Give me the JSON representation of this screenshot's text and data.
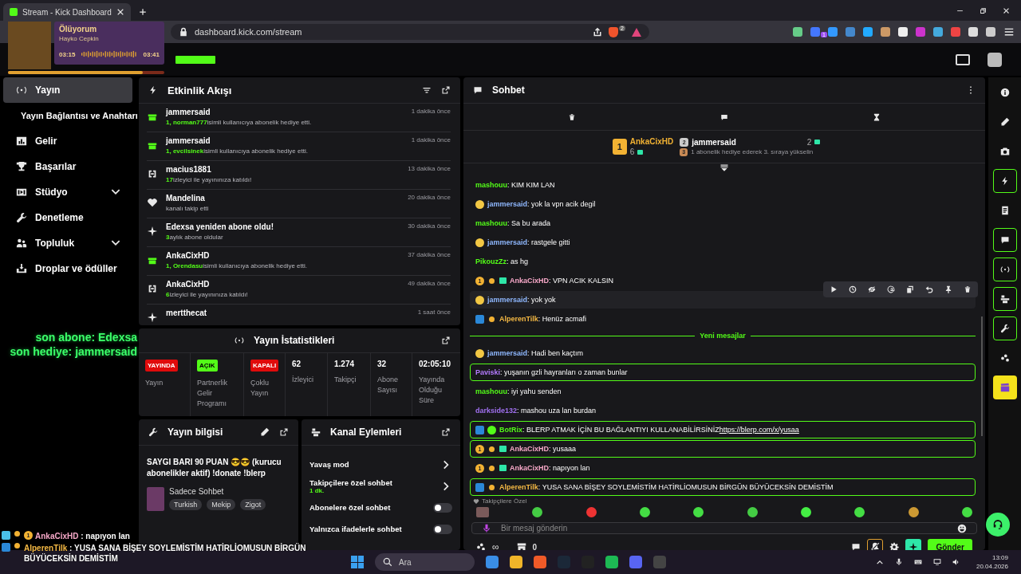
{
  "browser": {
    "tab_title": "Stream - Kick Dashboard",
    "url": "dashboard.kick.com/stream",
    "shield_count": "2",
    "extension_badge": "1"
  },
  "music_overlay": {
    "title": "Ölüyorum",
    "artist": "Hayko Cepkin",
    "elapsed": "03:15",
    "duration": "03:41",
    "level": 0.86
  },
  "sidebar": {
    "items": [
      {
        "label": "Yayın",
        "kind": "item",
        "selected": true,
        "expandable": false
      },
      {
        "label": "Yayın Bağlantısı ve Anahtarı",
        "kind": "subitem",
        "selected": false,
        "expandable": false
      },
      {
        "label": "Gelir",
        "kind": "item",
        "selected": false,
        "expandable": false
      },
      {
        "label": "Başarılar",
        "kind": "item",
        "selected": false,
        "expandable": false
      },
      {
        "label": "Stüdyo",
        "kind": "item",
        "selected": false,
        "expandable": true
      },
      {
        "label": "Denetleme",
        "kind": "item",
        "selected": false,
        "expandable": false
      },
      {
        "label": "Topluluk",
        "kind": "item",
        "selected": false,
        "expandable": true
      },
      {
        "label": "Droplar ve ödüller",
        "kind": "item",
        "selected": false,
        "expandable": false
      }
    ]
  },
  "stream_overlay": {
    "labels": [
      "son abone: Edexsa",
      "son hediye: jammersaid"
    ],
    "chat_lines": [
      {
        "badges": [
          {
            "kind": "cube"
          },
          {
            "kind": "dot"
          },
          {
            "kind": "rank",
            "label": "1"
          }
        ],
        "user": "AnkaCixHD",
        "color": "#f7a8c8",
        "text": ": napıyon lan"
      },
      {
        "badges": [
          {
            "kind": "mod"
          },
          {
            "kind": "dot"
          }
        ],
        "user": "AlperenTilk",
        "color": "#f5b944",
        "text": ": YUSA SANA BİŞEY SOYLEMİSTİM HATİRLİOMUSUN BİRGÜN BÜYÜCEKSİN DEMİSTİM"
      }
    ]
  },
  "event_feed": {
    "title": "Etkinlik Akışı",
    "items": [
      {
        "kind": "gift",
        "name": "jammersaid",
        "time": "1 dakika önce",
        "highlight": "1, norman777",
        "detail": "isimli kullanıcıya abonelik hediye etti."
      },
      {
        "kind": "gift",
        "name": "jammersaid",
        "time": "1 dakika önce",
        "highlight": "1, evcilsinek",
        "detail": "isimli kullanıcıya abonelik hediye etti."
      },
      {
        "kind": "raid",
        "name": "macius1881",
        "time": "13 dakika önce",
        "highlight": "17",
        "detail": "izleyici ile yayınınıza katıldı!"
      },
      {
        "kind": "follow",
        "name": "Mandelina",
        "time": "20 dakika önce",
        "detail": "kanalı takip etti"
      },
      {
        "kind": "resub",
        "name": "Edexsa yeniden abone oldu!",
        "time": "30 dakika önce",
        "highlight": "3",
        "detail": "aylık abone oldular"
      },
      {
        "kind": "gift",
        "name": "AnkaCixHD",
        "time": "37 dakika önce",
        "highlight": "1, Orendasu",
        "detail": "isimli kullanıcıya abonelik hediye etti."
      },
      {
        "kind": "raid",
        "name": "AnkaCixHD",
        "time": "49 dakika önce",
        "highlight": "6",
        "detail": "izleyici ile yayınınıza katıldı!"
      },
      {
        "kind": "resub",
        "name": "mertthecat",
        "time": "1 saat önce"
      }
    ]
  },
  "stream_stats": {
    "title": "Yayın İstatistikleri",
    "items": [
      {
        "kind": "badge",
        "value": "YAYINDA",
        "color": "#e00b0b",
        "label": "Yayın"
      },
      {
        "kind": "badge",
        "value": "AÇIK",
        "color": "#53fc18",
        "label": "Partnerlik Gelir Programı"
      },
      {
        "kind": "badge",
        "value": "KAPALI",
        "color": "#e00b0b",
        "label": "Çoklu Yayın"
      },
      {
        "kind": "number",
        "value": "62",
        "label": "İzleyici"
      },
      {
        "kind": "number",
        "value": "1.274",
        "label": "Takipçi"
      },
      {
        "kind": "number",
        "value": "32",
        "label": "Abone Sayısı"
      },
      {
        "kind": "number",
        "value": "02:05:10",
        "label": "Yayında Olduğu Süre"
      }
    ]
  },
  "stream_info": {
    "title": "Yayın bilgisi",
    "stream_title": "SAYGI BARI 90 PUAN 😎😎 (kurucu abonelikler aktif) !donate !blerp",
    "category": "Sadece Sohbet",
    "tags": [
      "Turkish",
      "Mekip",
      "Zigot"
    ]
  },
  "channel_actions": {
    "title": "Kanal Eylemleri",
    "items": [
      {
        "kind": "link",
        "label": "Yavaş mod"
      },
      {
        "kind": "link",
        "label": "Takipçilere özel sohbet",
        "sub": "1 dk."
      },
      {
        "kind": "toggle",
        "label": "Abonelere özel sohbet",
        "on": false
      },
      {
        "kind": "toggle",
        "label": "Yalnızca ifadelerle sohbet",
        "on": false
      }
    ]
  },
  "chat": {
    "title": "Sohbet",
    "leaders": [
      {
        "rank": "1",
        "name": "AnkaCixHD",
        "count": "6"
      },
      {
        "rank": "2",
        "name": "jammersaid",
        "count": "2"
      }
    ],
    "leader_hint": {
      "rank": "3",
      "text": "1 abonelik hediye ederek 3. sıraya yükselin"
    },
    "messages": [
      {
        "kind": "message",
        "user": "mashouu",
        "color": "#53fc18",
        "text": ": KIM KIM LAN",
        "highlighted": false,
        "hovered": false
      },
      {
        "kind": "message",
        "badges": [
          {
            "kind": "emoji"
          }
        ],
        "user": "jammersaid",
        "color": "#8fb8ff",
        "text": ": yok la vpn acik degil",
        "highlighted": false,
        "hovered": false
      },
      {
        "kind": "message",
        "user": "mashouu",
        "color": "#53fc18",
        "text": ": Sa bu arada",
        "highlighted": false,
        "hovered": false
      },
      {
        "kind": "message",
        "badges": [
          {
            "kind": "emoji"
          }
        ],
        "user": "jammersaid",
        "color": "#8fb8ff",
        "text": ": rastgele gitti",
        "highlighted": false,
        "hovered": false
      },
      {
        "kind": "message",
        "user": "PikouzZz",
        "color": "#53fc18",
        "text": ": as hg",
        "highlighted": false,
        "hovered": false
      },
      {
        "kind": "message",
        "badges": [
          {
            "kind": "rank",
            "label": "1"
          },
          {
            "kind": "dot"
          },
          {
            "kind": "gift"
          }
        ],
        "user": "AnkaCixHD",
        "color": "#f7a8c8",
        "text": ": VPN ACIK KALSIN",
        "highlighted": false,
        "hovered": false
      },
      {
        "kind": "message",
        "badges": [
          {
            "kind": "emoji"
          }
        ],
        "user": "jammersaid",
        "color": "#8fb8ff",
        "text": ": yok yok",
        "highlighted": false,
        "hovered": true
      },
      {
        "kind": "message",
        "badges": [
          {
            "kind": "mod"
          },
          {
            "kind": "dot"
          }
        ],
        "user": "AlperenTilk",
        "color": "#f5b944",
        "text": ": Henüz acmafi",
        "highlighted": false,
        "hovered": false
      },
      {
        "kind": "divider",
        "label": "Yeni mesajlar"
      },
      {
        "kind": "message",
        "badges": [
          {
            "kind": "emoji"
          }
        ],
        "user": "jammersaid",
        "color": "#8fb8ff",
        "text": ": Hadi ben kaçtım",
        "highlighted": false,
        "hovered": false
      },
      {
        "kind": "message",
        "user": "Paviski",
        "color": "#b57bff",
        "text": ": yuşanın gzli hayranları o zaman bunlar",
        "highlighted": true,
        "hovered": false
      },
      {
        "kind": "message",
        "user": "mashouu",
        "color": "#53fc18",
        "text": ": iyi yahu senden",
        "highlighted": false,
        "hovered": false
      },
      {
        "kind": "message",
        "user": "darkside132",
        "color": "#a070f0",
        "text": ": mashou uza lan burdan",
        "highlighted": false,
        "hovered": false
      },
      {
        "kind": "message",
        "badges": [
          {
            "kind": "mod"
          },
          {
            "kind": "verified"
          }
        ],
        "user": "BotRix",
        "color": "#53fc18",
        "text": ": BLERP ATMAK İÇİN BU BAĞLANTIYI KULLANABİLİRSİNİZ",
        "link": "https://blerp.com/x/yusaa",
        "highlighted": true,
        "hovered": false
      },
      {
        "kind": "message",
        "badges": [
          {
            "kind": "rank",
            "label": "1"
          },
          {
            "kind": "dot"
          },
          {
            "kind": "gift"
          }
        ],
        "user": "AnkaCixHD",
        "color": "#f7a8c8",
        "text": ": yusaaa",
        "highlighted": true,
        "hovered": false
      },
      {
        "kind": "message",
        "badges": [
          {
            "kind": "rank",
            "label": "1"
          },
          {
            "kind": "dot"
          },
          {
            "kind": "gift"
          }
        ],
        "user": "AnkaCixHD",
        "color": "#f7a8c8",
        "text": ": napıyon lan",
        "highlighted": false,
        "hovered": false
      },
      {
        "kind": "message",
        "badges": [
          {
            "kind": "mod"
          },
          {
            "kind": "dot"
          }
        ],
        "user": "AlperenTilk",
        "color": "#f5b944",
        "text": ": YUSA SANA BİŞEY SOYLEMİSTİM HATİRLİOMUSUN BİRGÜN BÜYÜCEKSİN DEMİSTİM",
        "highlighted": true,
        "hovered": false
      }
    ],
    "emote_section": "Takipçilere Özel",
    "input_placeholder": "Bir mesaj gönderin",
    "points": "∞",
    "store_count": "0",
    "send_label": "Gönder"
  },
  "right_rail": [
    {
      "on": false
    },
    {
      "on": false
    },
    {
      "on": false
    },
    {
      "on": true
    },
    {
      "on": false
    },
    {
      "on": true
    },
    {
      "on": true
    },
    {
      "on": true
    },
    {
      "on": true
    },
    {
      "on": false
    },
    {
      "on": false
    }
  ],
  "taskbar": {
    "search_placeholder": "Ara",
    "time": "13:09",
    "date": "20.04.2026"
  }
}
